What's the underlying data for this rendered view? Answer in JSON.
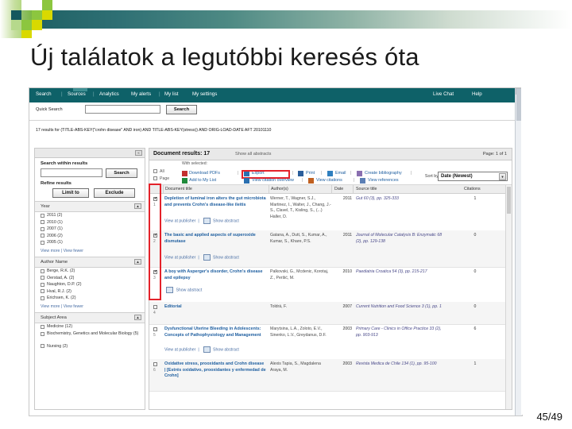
{
  "slide": {
    "title": "Új találatok a legutóbbi keresés óta",
    "page_number": "45/49"
  },
  "colors": {
    "nav_teal": "#0e6168",
    "link_blue": "#1f5fa0",
    "highlight_red": "#e4222a",
    "accent_green": "#8cc63f",
    "accent_yellow": "#d9d900"
  },
  "nav": {
    "items": [
      "Search",
      "Sources",
      "Analytics",
      "My alerts",
      "My list",
      "My settings"
    ],
    "right_items": [
      "Live Chat",
      "Help"
    ]
  },
  "quick_search": {
    "label": "Quick Search",
    "value": "",
    "placeholder": "",
    "button": "Search"
  },
  "query_line": {
    "count": "17 results",
    "text": "17 results for (TITLE-ABS-KEY(\"crohn disease\" AND iron) AND TITLE-ABS-KEY(stress)) AND ORIG-LOAD-DATE AFT 20101110"
  },
  "facets": {
    "search_within": {
      "label": "Search within results",
      "value": "",
      "button": "Search"
    },
    "refine": {
      "label": "Refine results",
      "limit_to": "Limit to",
      "exclude": "Exclude"
    },
    "groups": [
      {
        "name": "Year",
        "items": [
          "2011 (2)",
          "2010 (1)",
          "2007 (1)",
          "2006 (2)",
          "2005 (1)"
        ],
        "view_more": "View more",
        "view_fewer": "View fewer"
      },
      {
        "name": "Author Name",
        "items": [
          "Berge, R.K. (2)",
          "Oerstad, A. (2)",
          "Naughton, D.P. (2)",
          "Hval, R.J. (2)",
          "Erichsen, K. (2)"
        ],
        "view_more": "View more",
        "view_fewer": "View fewer"
      },
      {
        "name": "Subject Area",
        "items": [
          "Medicine (12)",
          "Biochemistry, Genetics and Molecular Biology (5)",
          "Nursing (2)"
        ],
        "view_more": "",
        "view_fewer": ""
      }
    ]
  },
  "results": {
    "header": "Document results: 17",
    "show_abstracts": "Show all abstracts",
    "page_of": "Page: 1 of 1",
    "with_selected": "With selected:",
    "select_all": "All",
    "select_page": "Page",
    "toolbar_row1": [
      "Download PDFs",
      "Export",
      "Print",
      "Email",
      "Create bibliography"
    ],
    "toolbar_row2": [
      "Add to My List",
      "View citation overview",
      "View citations",
      "View references"
    ],
    "sort_label": "Sort by",
    "sort_value": "Date (Newest)",
    "columns": [
      "Document title",
      "Author(s)",
      "Date",
      "Source title",
      "Citations"
    ],
    "view_at_publisher": "View at publisher",
    "show_abstract": "Show abstract",
    "rows": [
      {
        "num": "1",
        "checked": true,
        "title": "Depletion of luminal iron alters the gut microbiota and prevents Crohn's disease-like ileitis",
        "authors": "Werner, T., Wagner, S.J., Martinez, I., Walter, J., Chang, J.-S., Clavel, T., Kisling, S., (...) Haller, D.",
        "date": "2011",
        "source": "Gut 60 (3), pp. 325-333",
        "citations": "1",
        "links": [
          "View at publisher",
          "Show abstract"
        ]
      },
      {
        "num": "2",
        "checked": true,
        "title": "The basic and applied aspects of superoxide dismutase",
        "authors": "Gatana, A., Dutt, S., Kumar, A., Kumar, S., Khare, P.S.",
        "date": "2011",
        "source": "Journal of Molecular Catalysis B: Enzymatic 68 (2), pp. 129-138",
        "citations": "0",
        "links": [
          "View at publisher",
          "Show abstract"
        ]
      },
      {
        "num": "3",
        "checked": true,
        "title": "A boy with Asperger's disorder, Crohn's disease and epilepsy",
        "authors": "Palkovski, G., Mcdenic, Korotaj, Z., Peršić, M.",
        "date": "2010",
        "source": "Paediatria Croatica 54 (3), pp. 215-217",
        "citations": "0",
        "links": [
          "Show abstract"
        ]
      },
      {
        "num": "4",
        "checked": false,
        "title": "Editorial",
        "authors": "Toldrá, F.",
        "date": "2007",
        "source": "Current Nutrition and Food Science 3 (1), pp. 1",
        "citations": "0",
        "links": []
      },
      {
        "num": "5",
        "checked": false,
        "title": "Dysfunctional Uterine Bleeding in Adolescents: Concepts of Pathophysiology and Management",
        "authors": "Marytsina, L.A., Zoloto, E.V., Sinenko, L.V., Greydanus, D.F.",
        "date": "2003",
        "source": "Primary Care - Clinics in Office Practice 33 (2), pp. 903-913",
        "citations": "6",
        "links": [
          "View at publisher",
          "Show abstract"
        ]
      },
      {
        "num": "6",
        "checked": false,
        "title": "Oxidative stress, prooxidants and Crohn disease | [Estrés oxidativo, prooxidantes y enfermedad de Crohn]",
        "authors": "Alexis Tapia, S., Magdalena Araya, M.",
        "date": "2003",
        "source": "Revista Medica de Chile 134 (1), pp. 95-100",
        "citations": "1",
        "links": []
      }
    ]
  },
  "icons": {
    "collapse": "«",
    "toggle": "▲",
    "chevron_down": "▾",
    "scroll_up": "▴"
  }
}
